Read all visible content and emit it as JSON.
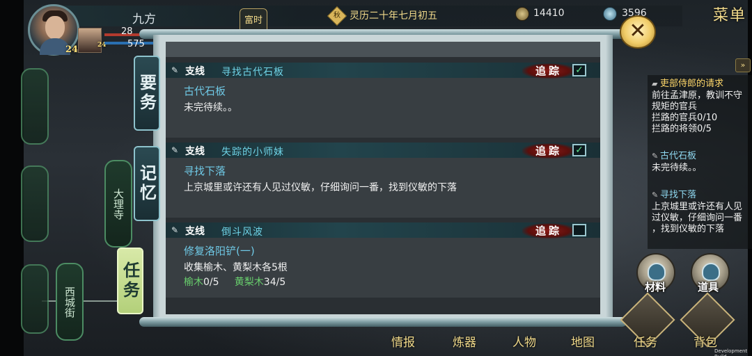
{
  "player": {
    "name": "九方",
    "level": "24",
    "hp": "28",
    "mp": "575",
    "companion_level": "24"
  },
  "top": {
    "time_badge": "富时",
    "season_icon": "秋",
    "date": "灵历二十年七月初五",
    "currency1": "14410",
    "currency2": "3596",
    "menu_title": "菜单",
    "expand_arrow": "»"
  },
  "tabs": {
    "important": "要务",
    "memory": "记忆",
    "tasks": "任务"
  },
  "map": {
    "node_dali": "大理寺",
    "node_xicheng": "西城街"
  },
  "quests": [
    {
      "type": "支线",
      "title": "寻找古代石板",
      "track_label": "追踪",
      "tracked": true,
      "checkmark": "✓",
      "subtitle": "古代石板",
      "desc": "未完待续。。",
      "progress": []
    },
    {
      "type": "支线",
      "title": "失踪的小师妹",
      "track_label": "追踪",
      "tracked": true,
      "checkmark": "✓",
      "subtitle": "寻找下落",
      "desc": "上京城里或许还有人见过仪敏，仔细询问一番，找到仪敏的下落",
      "progress": []
    },
    {
      "type": "支线",
      "title": "倒斗风波",
      "track_label": "追踪",
      "tracked": false,
      "checkmark": "",
      "subtitle": "修复洛阳铲(一)",
      "desc": "收集榆木、黄梨木各5根",
      "progress": [
        {
          "item": "榆木",
          "count": "0/5"
        },
        {
          "item": "黄梨木",
          "count": "34/5"
        }
      ]
    }
  ],
  "tracker": [
    {
      "title": "吏部侍郎的请求",
      "lines": [
        "前往孟津原，教训不守",
        "规矩的官兵",
        "拦路的官兵0/10",
        "拦路的将领0/5"
      ]
    },
    {
      "title": "古代石板",
      "lines": [
        "未完待续。。"
      ]
    },
    {
      "title": "寻找下落",
      "lines": [
        "上京城里或许还有人见",
        "过仪敏，仔细询问一番",
        "，找到仪敏的下落"
      ]
    }
  ],
  "bottom": {
    "materials": "材料",
    "items": "道具",
    "intel": "情报",
    "refine": "炼器",
    "characters": "人物",
    "map": "地图",
    "tasks": "任务",
    "bag": "背包"
  },
  "dev_build": "Development Build",
  "icons": [
    "close-icon",
    "checkmark-icon",
    "brush-icon",
    "coin-icon",
    "swirl-icon",
    "expand-icon"
  ],
  "colors": {
    "accent_cyan": "#6fd3e6",
    "accent_gold": "#f0d98a",
    "track_red": "#8a1a16",
    "progress_green": "#69d06d"
  }
}
